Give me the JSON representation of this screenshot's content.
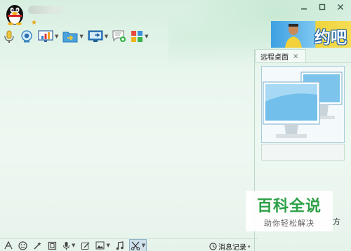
{
  "header": {
    "window_controls": [
      "minimize-icon",
      "maximize-icon",
      "close-icon"
    ],
    "ad_text": "约吧"
  },
  "side_panel": {
    "tab_label": "远程桌面",
    "tab_close": "×",
    "peek_text": "方"
  },
  "history": {
    "label": "消息记录",
    "caret": "▾"
  },
  "watermark": {
    "title": "百科全说",
    "subtitle": "助你轻松解决"
  },
  "colors": {
    "background": "#e9f6ee",
    "accent_green": "#1e9a3a",
    "ad_yellow": "#f4dc55",
    "ad_blue": "#3da0e0"
  }
}
